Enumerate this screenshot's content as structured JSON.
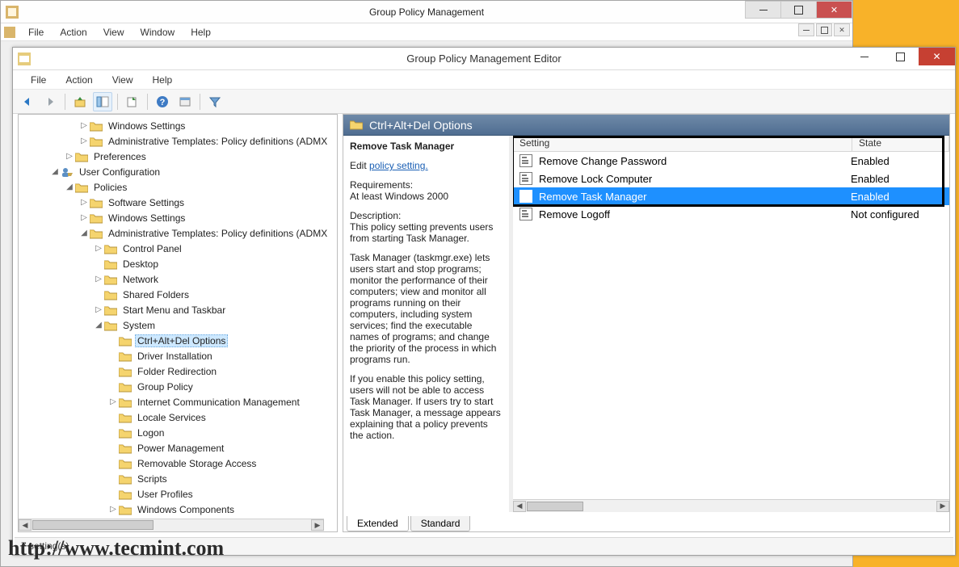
{
  "outer": {
    "title": "Group Policy Management",
    "menubar": [
      "File",
      "Action",
      "View",
      "Window",
      "Help"
    ]
  },
  "editor": {
    "title": "Group Policy Management Editor",
    "menubar": [
      "File",
      "Action",
      "View",
      "Help"
    ],
    "status": "7 setting(s)"
  },
  "right_header": "Ctrl+Alt+Del Options",
  "desc": {
    "title": "Remove Task Manager",
    "edit_prefix": "Edit ",
    "link": "policy setting.",
    "req_label": "Requirements:",
    "req_text": "At least Windows 2000",
    "desc_label": "Description:",
    "p1": "This policy setting prevents users from starting Task Manager.",
    "p2": "Task Manager (taskmgr.exe) lets users start and stop programs; monitor the performance of their computers; view and monitor all programs running on their computers, including system services; find the executable names of programs; and change the priority of the process in which programs run.",
    "p3": "If you enable this policy setting, users will not be able to access Task Manager. If users try to start Task Manager, a message appears explaining that a policy prevents the action."
  },
  "list": {
    "col_setting": "Setting",
    "col_state": "State",
    "rows": [
      {
        "setting": "Remove Change Password",
        "state": "Enabled",
        "selected": false
      },
      {
        "setting": "Remove Lock Computer",
        "state": "Enabled",
        "selected": false
      },
      {
        "setting": "Remove Task Manager",
        "state": "Enabled",
        "selected": true
      },
      {
        "setting": "Remove Logoff",
        "state": "Not configured",
        "selected": false
      }
    ]
  },
  "tabs": {
    "extended": "Extended",
    "standard": "Standard"
  },
  "tree": [
    {
      "d": 3,
      "exp": "▷",
      "icon": "folder",
      "label": "Windows Settings"
    },
    {
      "d": 3,
      "exp": "▷",
      "icon": "folder",
      "label": "Administrative Templates: Policy definitions (ADMX"
    },
    {
      "d": 2,
      "exp": "▷",
      "icon": "folder",
      "label": "Preferences"
    },
    {
      "d": 1,
      "exp": "◢",
      "icon": "userconf",
      "label": "User Configuration"
    },
    {
      "d": 2,
      "exp": "◢",
      "icon": "folder",
      "label": "Policies"
    },
    {
      "d": 3,
      "exp": "▷",
      "icon": "folder",
      "label": "Software Settings"
    },
    {
      "d": 3,
      "exp": "▷",
      "icon": "folder",
      "label": "Windows Settings"
    },
    {
      "d": 3,
      "exp": "◢",
      "icon": "folder",
      "label": "Administrative Templates: Policy definitions (ADMX"
    },
    {
      "d": 4,
      "exp": "▷",
      "icon": "folder",
      "label": "Control Panel"
    },
    {
      "d": 4,
      "exp": "",
      "icon": "folder",
      "label": "Desktop"
    },
    {
      "d": 4,
      "exp": "▷",
      "icon": "folder",
      "label": "Network"
    },
    {
      "d": 4,
      "exp": "",
      "icon": "folder",
      "label": "Shared Folders"
    },
    {
      "d": 4,
      "exp": "▷",
      "icon": "folder",
      "label": "Start Menu and Taskbar"
    },
    {
      "d": 4,
      "exp": "◢",
      "icon": "folder",
      "label": "System"
    },
    {
      "d": 5,
      "exp": "",
      "icon": "folder",
      "label": "Ctrl+Alt+Del Options",
      "selected": true
    },
    {
      "d": 5,
      "exp": "",
      "icon": "folder",
      "label": "Driver Installation"
    },
    {
      "d": 5,
      "exp": "",
      "icon": "folder",
      "label": "Folder Redirection"
    },
    {
      "d": 5,
      "exp": "",
      "icon": "folder",
      "label": "Group Policy"
    },
    {
      "d": 5,
      "exp": "▷",
      "icon": "folder",
      "label": "Internet Communication Management"
    },
    {
      "d": 5,
      "exp": "",
      "icon": "folder",
      "label": "Locale Services"
    },
    {
      "d": 5,
      "exp": "",
      "icon": "folder",
      "label": "Logon"
    },
    {
      "d": 5,
      "exp": "",
      "icon": "folder",
      "label": "Power Management"
    },
    {
      "d": 5,
      "exp": "",
      "icon": "folder",
      "label": "Removable Storage Access"
    },
    {
      "d": 5,
      "exp": "",
      "icon": "folder",
      "label": "Scripts"
    },
    {
      "d": 5,
      "exp": "",
      "icon": "folder",
      "label": "User Profiles"
    },
    {
      "d": 5,
      "exp": "▷",
      "icon": "folder",
      "label": "Windows Components"
    }
  ],
  "watermark": "http://www.tecmint.com"
}
